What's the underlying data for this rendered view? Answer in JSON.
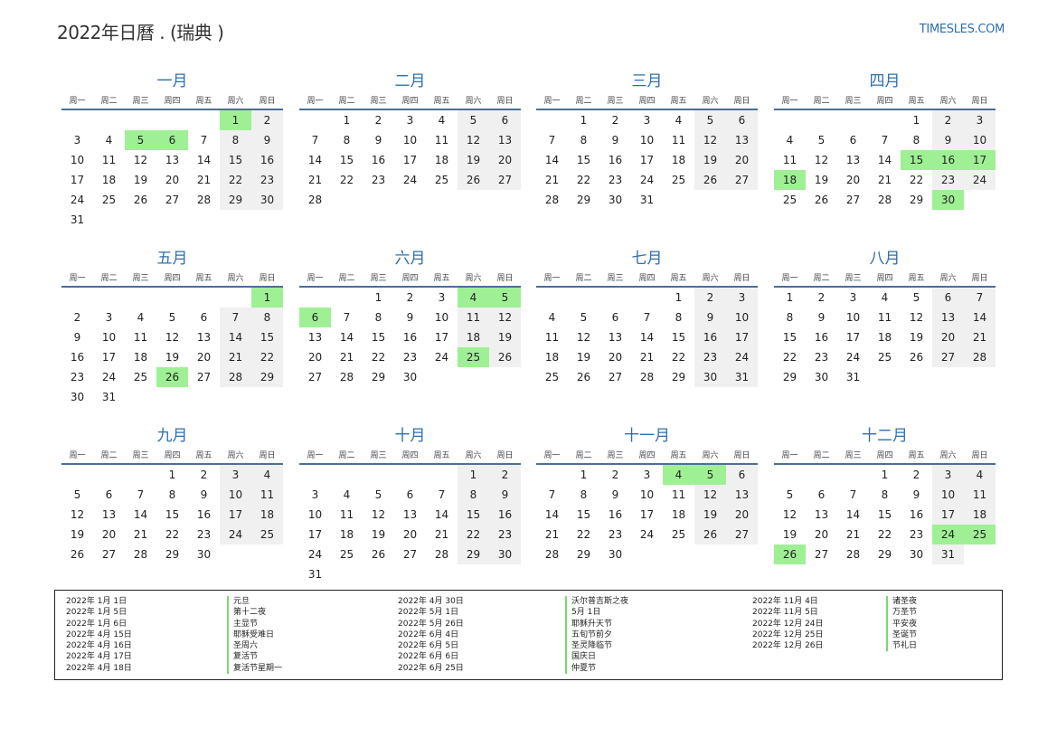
{
  "header": {
    "title": "2022年日曆 . (瑞典 )",
    "site": "TIMESLES.COM"
  },
  "weekday_labels": [
    "周一",
    "周二",
    "周三",
    "周四",
    "周五",
    "周六",
    "周日"
  ],
  "months": [
    {
      "name": "一月",
      "offset": 5,
      "days": 31,
      "holidays": [
        1,
        5,
        6
      ]
    },
    {
      "name": "二月",
      "offset": 1,
      "days": 28,
      "holidays": []
    },
    {
      "name": "三月",
      "offset": 1,
      "days": 31,
      "holidays": []
    },
    {
      "name": "四月",
      "offset": 4,
      "days": 30,
      "holidays": [
        15,
        16,
        17,
        18,
        30
      ]
    },
    {
      "name": "五月",
      "offset": 6,
      "days": 31,
      "holidays": [
        1,
        26
      ]
    },
    {
      "name": "六月",
      "offset": 2,
      "days": 30,
      "holidays": [
        4,
        5,
        6,
        25
      ]
    },
    {
      "name": "七月",
      "offset": 4,
      "days": 31,
      "holidays": []
    },
    {
      "name": "八月",
      "offset": 0,
      "days": 31,
      "holidays": []
    },
    {
      "name": "九月",
      "offset": 3,
      "days": 30,
      "holidays": []
    },
    {
      "name": "十月",
      "offset": 5,
      "days": 31,
      "holidays": []
    },
    {
      "name": "十一月",
      "offset": 1,
      "days": 30,
      "holidays": [
        4,
        5
      ]
    },
    {
      "name": "十二月",
      "offset": 3,
      "days": 31,
      "holidays": [
        24,
        25,
        26
      ]
    }
  ],
  "colors": {
    "accent": "#2f6fae",
    "holiday": "#9ff095",
    "weekend": "#f0f0f0",
    "holiday_marker": "#7bd86f"
  },
  "legend": [
    {
      "dates": [
        "2022年 1月 1日",
        "2022年 1月 5日",
        "2022年 1月 6日",
        "2022年 4月 15日",
        "2022年 4月 16日",
        "2022年 4月 17日",
        "2022年 4月 18日"
      ],
      "names": [
        "元旦",
        "第十二夜",
        "主显节",
        "耶稣受难日",
        "圣周六",
        "复活节",
        "复活节星期一"
      ]
    },
    {
      "dates": [
        "2022年 4月 30日",
        "2022年 5月 1日",
        "2022年 5月 26日",
        "2022年 6月 4日",
        "2022年 6月 5日",
        "2022年 6月 6日",
        "2022年 6月 25日"
      ],
      "names": [
        "沃尔普吉斯之夜",
        "5月 1日",
        "耶稣升天节",
        "五旬节前夕",
        "圣灵降临节",
        "国庆日",
        "仲夏节"
      ]
    },
    {
      "dates": [
        "2022年 11月 4日",
        "2022年 11月 5日",
        "2022年 12月 24日",
        "2022年 12月 25日",
        "2022年 12月 26日"
      ],
      "names": [
        "诸圣夜",
        "万圣节",
        "平安夜",
        "圣诞节",
        "节礼日"
      ]
    }
  ]
}
